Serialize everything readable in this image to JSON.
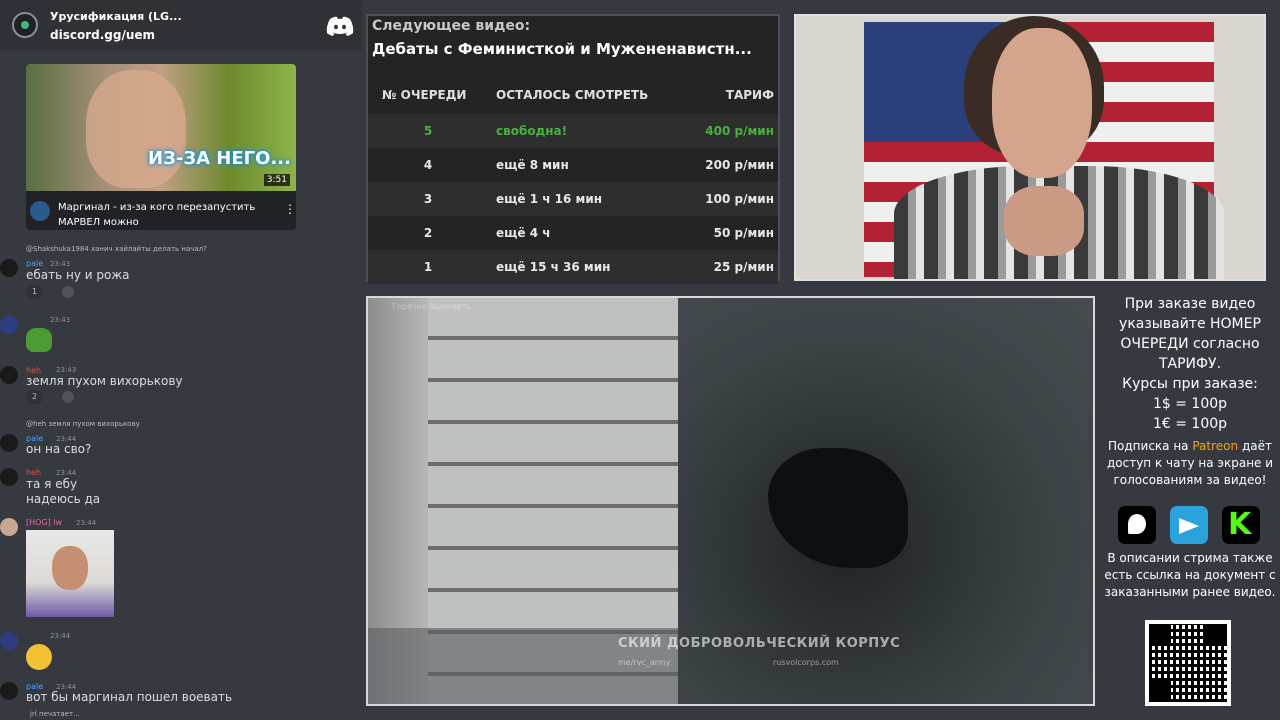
{
  "discord": {
    "server_name": "Урусификация (LG...",
    "server_link": "discord.gg/uem",
    "icon": "discord-logo-icon"
  },
  "youtube_card": {
    "thumbnail_text": "ИЗ-ЗА НЕГО...",
    "duration": "3:51",
    "title": "Маргинал - из-за кого перезапустить МАРВЕЛ можно"
  },
  "chat": [
    {
      "reply": "@Shakshuka1984 ханич хайлайты делать начал?",
      "name": "pale",
      "time": "23:43",
      "text": "ебать ну и рожа",
      "reaction_count": "1"
    },
    {
      "name": "",
      "time": "23:43",
      "emoji": "pepe-icon"
    },
    {
      "name": "heh",
      "time": "23:43",
      "text": "земля пухом вихорькову",
      "reaction_count": "2"
    },
    {
      "reply": "@heh земля пухом вихорькову",
      "name": "pale",
      "time": "23:44",
      "text": "он на сво?"
    },
    {
      "name": "heh",
      "time": "23:44",
      "text": "та я ебу",
      "text2": "надеюсь да"
    },
    {
      "name": "[HOG] lw",
      "time": "23:44",
      "image": "webcam-snapshot"
    },
    {
      "name": "",
      "time": "23:44",
      "emoji": "laughing-emoji-icon"
    },
    {
      "name": "pale",
      "time": "23:44",
      "text": "вот бы маргинал пошел воевать"
    }
  ],
  "typing": "jrl печатает...",
  "queue": {
    "label": "Следующее видео:",
    "title": "Дебаты с Феминисткой и Мужененавистн...",
    "headers": {
      "num": "№ ОЧЕРЕДИ",
      "remaining": "ОСТАЛОСЬ СМОТРЕТЬ",
      "price": "ТАРИФ"
    },
    "rows": [
      {
        "num": "5",
        "remaining": "свободна!",
        "price": "400 р/мин",
        "free": true
      },
      {
        "num": "4",
        "remaining": "ещё 8 мин",
        "price": "200 р/мин"
      },
      {
        "num": "3",
        "remaining": "ещё 1 ч 16 мин",
        "price": "100 р/мин"
      },
      {
        "num": "2",
        "remaining": "ещё 4 ч",
        "price": "50 р/мин"
      },
      {
        "num": "1",
        "remaining": "ещё 15 ч 36 мин",
        "price": "25 р/мин"
      }
    ]
  },
  "video": {
    "watermark_main": "СКИЙ ДОБРОВОЛЬЧЕСКИЙ КОРПУС",
    "watermark_handle": "me/rvc_army",
    "watermark_site": "rusvolcorps.com",
    "logo_text": "Горячие Ашинавть"
  },
  "info": {
    "order_text": "При заказе видео указывайте НОМЕР ОЧЕРЕДИ согласно ТАРИФУ.",
    "rates_title": "Курсы при заказе:",
    "rate_usd": "1$ = 100р",
    "rate_eur": "1€ = 100р",
    "sub_prefix": "Подписка на ",
    "sub_patreon": "Patreon",
    "sub_suffix": " даёт доступ к чату на экране и голосованиям за видео!",
    "desc": "В описании стрима также есть ссылка на документ с заказанными ранее видео.",
    "colors": {
      "patreon": "#f4a11b",
      "free": "#49b041",
      "telegram": "#2aa3dd",
      "kick": "#53fc18"
    }
  }
}
